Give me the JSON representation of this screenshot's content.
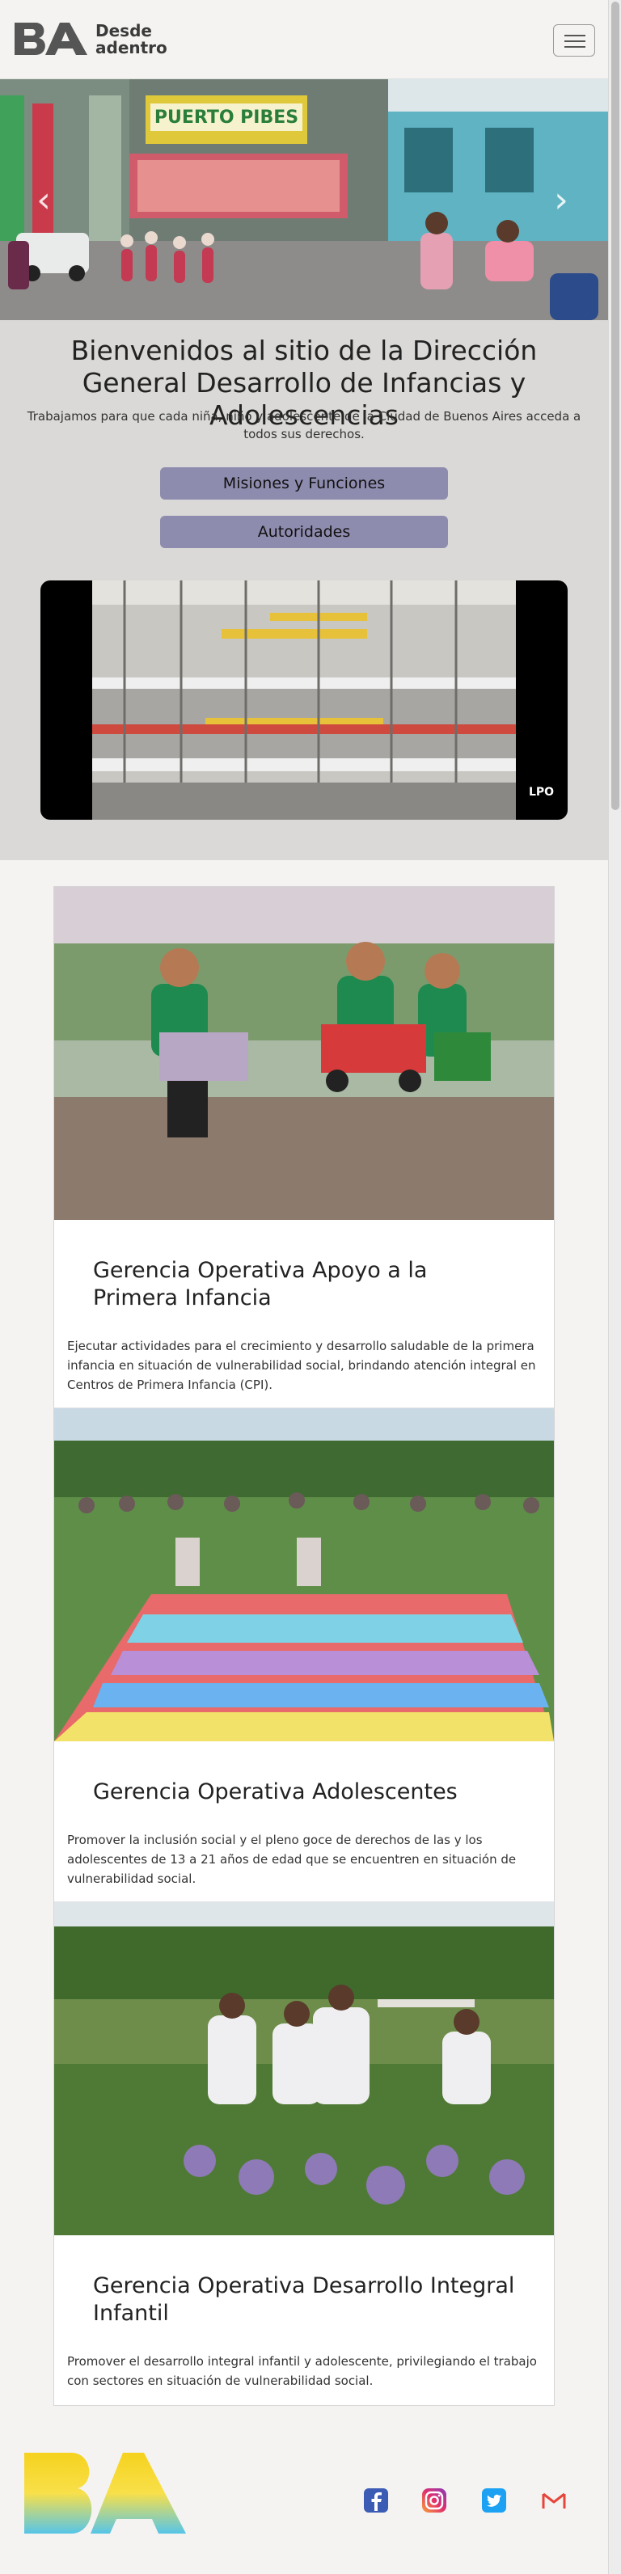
{
  "header": {
    "brand_line1": "Desde",
    "brand_line2": "adentro",
    "menu_icon": "hamburger-icon"
  },
  "hero": {
    "sign_text": "PUERTO PIBES",
    "prev_icon": "chevron-left-icon",
    "next_icon": "chevron-right-icon"
  },
  "intro": {
    "title": "Bienvenidos al sitio de la Dirección General Desarrollo de Infancias y Adolescencias",
    "text": "Trabajamos para que cada niña, niño y adolescente de la Ciudad de Buenos Aires acceda a todos sus derechos.",
    "button_mision": "Misiones y Funciones",
    "button_autoridades": "Autoridades",
    "video_badge": "LPO"
  },
  "cards": [
    {
      "title": "Gerencia Operativa Apoyo a la Primera Infancia",
      "text": "Ejecutar actividades para el crecimiento y desarrollo saludable de la primera infancia en situación de vulnerabilidad social, brindando atención integral en Centros de Primera Infancia (CPI)."
    },
    {
      "title": "Gerencia Operativa Adolescentes",
      "text": "Promover la inclusión social y el pleno goce de derechos de las y los adolescentes de 13 a 21 años de edad que se encuentren en situación de vulnerabilidad social."
    },
    {
      "title": "Gerencia Operativa Desarrollo Integral Infantil",
      "text": "Promover el desarrollo integral infantil y adolescente, privilegiando el trabajo con sectores en situación de vulnerabilidad social."
    }
  ],
  "footer": {
    "social": [
      "facebook-icon",
      "instagram-icon",
      "twitter-icon",
      "gmail-icon"
    ]
  },
  "colors": {
    "button": "#8e8cae",
    "intro_bg": "#dad9d7",
    "page_bg": "#f4f3f1"
  }
}
